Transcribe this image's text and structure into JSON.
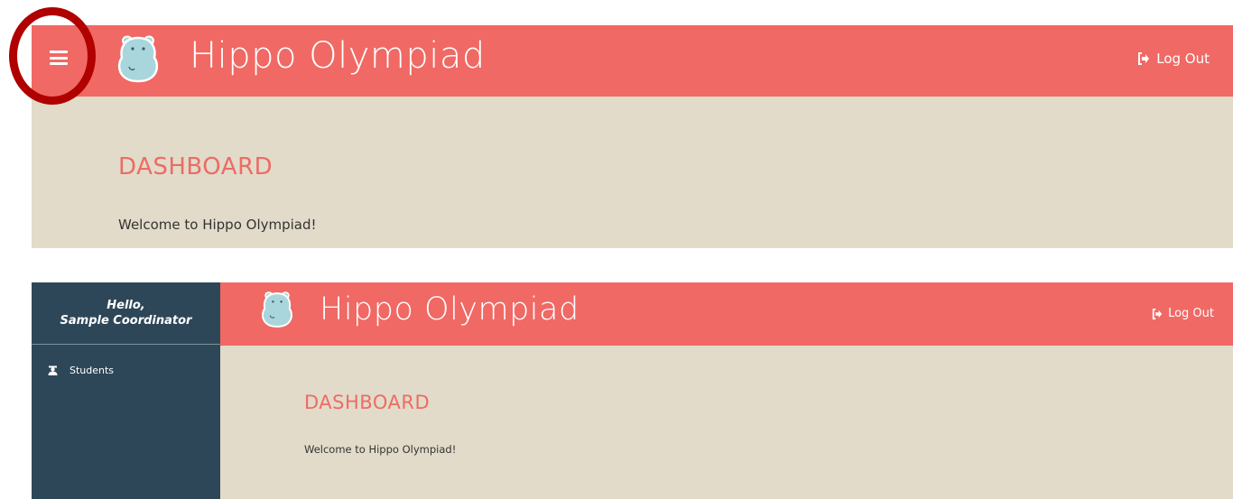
{
  "views": [
    {
      "header": {
        "title": "Hippo Olympiad",
        "logout_label": "Log Out"
      },
      "main": {
        "heading": "DASHBOARD",
        "welcome": "Welcome to Hippo Olympiad!"
      }
    },
    {
      "header": {
        "title": "Hippo Olympiad",
        "logout_label": "Log Out"
      },
      "sidebar": {
        "greeting_line1": "Hello,",
        "greeting_line2": "Sample Coordinator",
        "items": [
          {
            "label": "Students",
            "icon": "user-graduate-icon"
          }
        ]
      },
      "main": {
        "heading": "DASHBOARD",
        "welcome": "Welcome to Hippo Olympiad!"
      }
    }
  ],
  "icons": {
    "menu": "hamburger-menu-icon",
    "logo": "hippo-logo-icon",
    "logout": "sign-out-icon"
  },
  "colors": {
    "header": "#f06964",
    "content_bg": "#e2dbc9",
    "sidebar_bg": "#2e4758",
    "heading": "#ed6b66",
    "highlight_ring": "#b00000"
  }
}
